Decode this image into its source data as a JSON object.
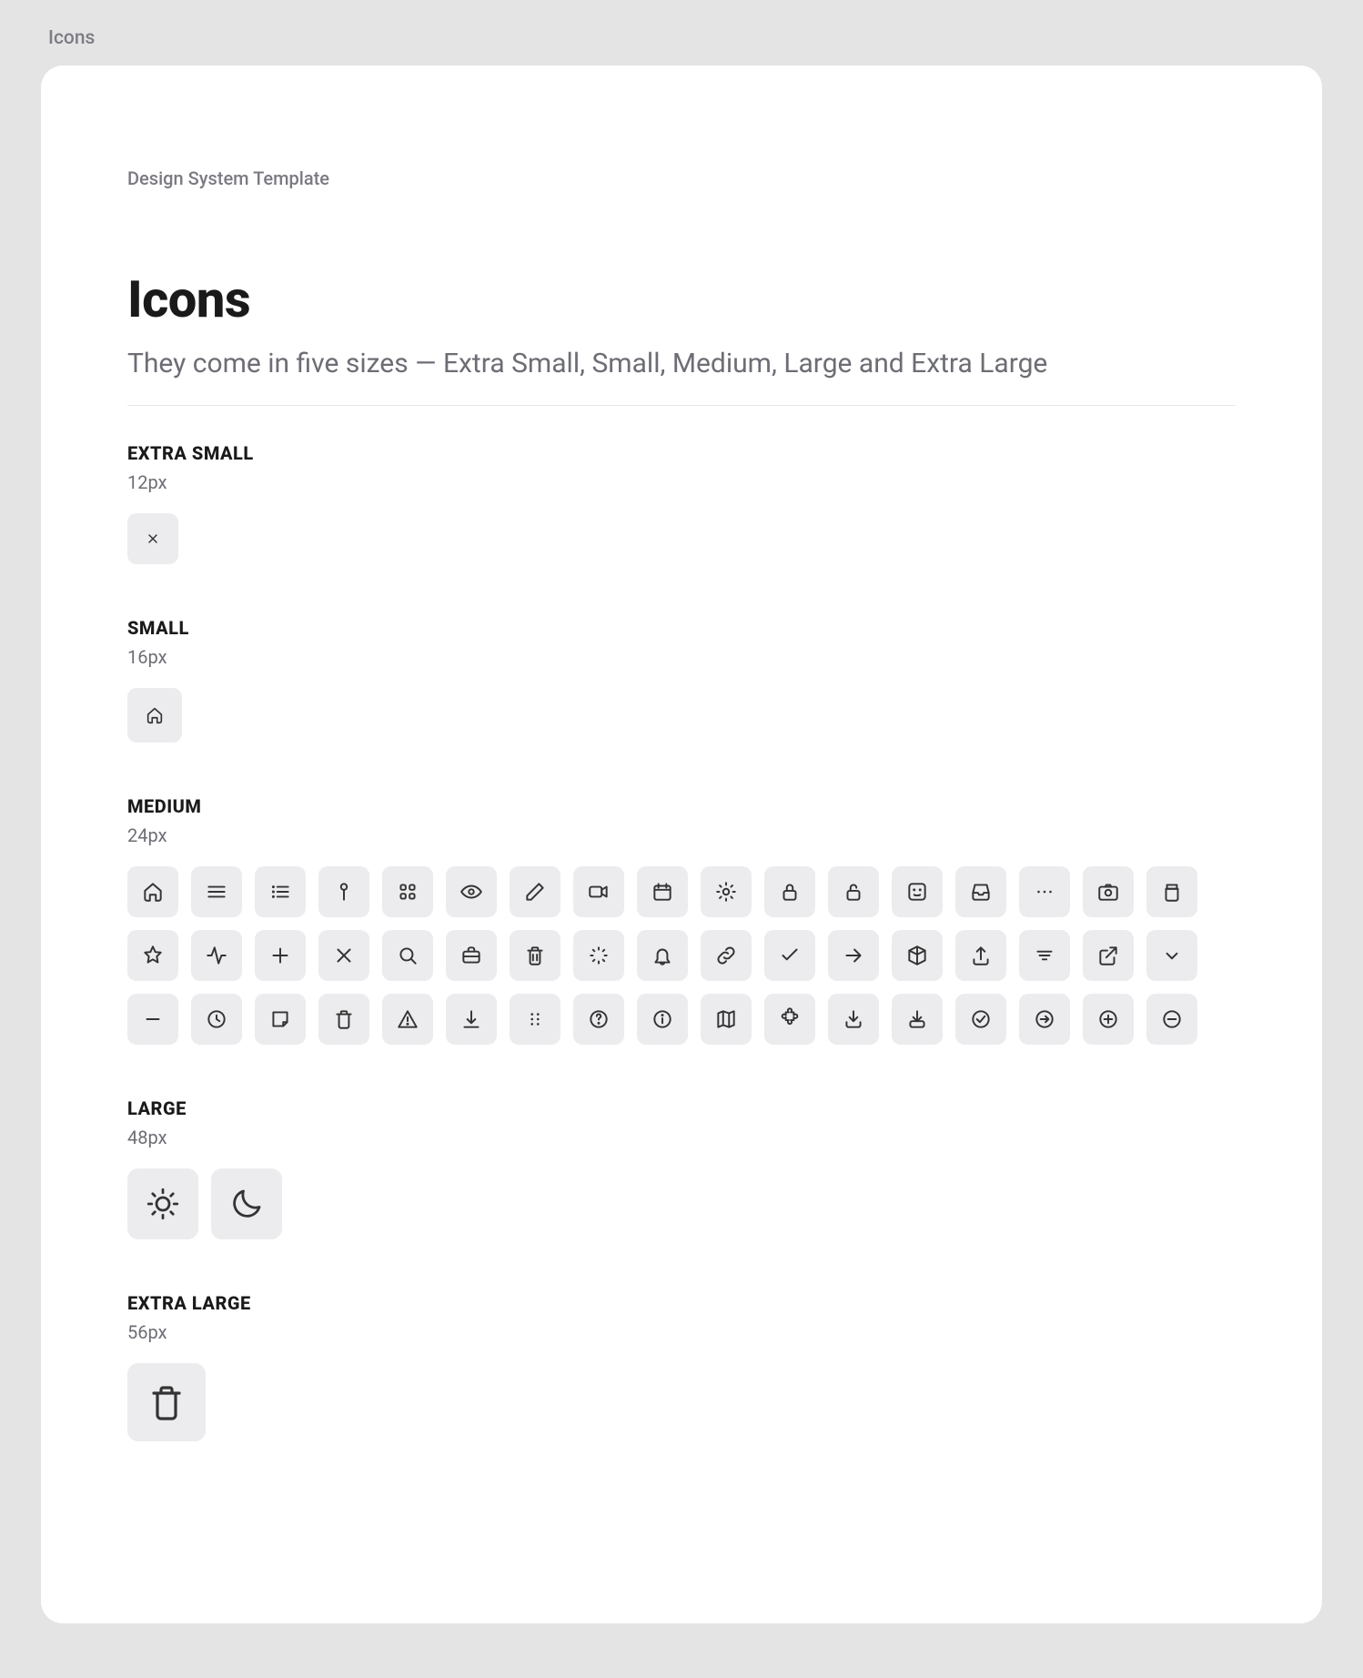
{
  "tab": "Icons",
  "breadcrumb": "Design System Template",
  "title": "Icons",
  "subtitle": "They come in five sizes — Extra Small, Small, Medium, Large and Extra Large",
  "sections": {
    "xs": {
      "label": "EXTRA SMALL",
      "size": "12px"
    },
    "s": {
      "label": "SMALL",
      "size": "16px"
    },
    "m": {
      "label": "MEDIUM",
      "size": "24px"
    },
    "l": {
      "label": "LARGE",
      "size": "48px"
    },
    "xl": {
      "label": "EXTRA LARGE",
      "size": "56px"
    }
  },
  "icons": {
    "xs": [
      "x"
    ],
    "s": [
      "home"
    ],
    "m_row1": [
      "home",
      "menu",
      "list",
      "pin",
      "grid",
      "eye",
      "pencil",
      "video",
      "calendar",
      "gear",
      "lock",
      "unlock",
      "face",
      "inbox",
      "more",
      "camera",
      "archive"
    ],
    "m_row2": [
      "star",
      "activity",
      "plus",
      "x",
      "search",
      "briefcase",
      "trash",
      "loading",
      "bell",
      "link",
      "check",
      "arrow-right",
      "cube",
      "upload",
      "filter",
      "external-link",
      "chevron-down"
    ],
    "m_row3": [
      "minus",
      "clock",
      "note",
      "trash",
      "warning",
      "download",
      "drag",
      "help",
      "info",
      "map",
      "puzzle",
      "download-tray",
      "import",
      "check-circle",
      "arrow-circle",
      "plus-circle",
      "minus-circle"
    ],
    "l": [
      "sun",
      "moon"
    ],
    "xl": [
      "trash"
    ]
  }
}
